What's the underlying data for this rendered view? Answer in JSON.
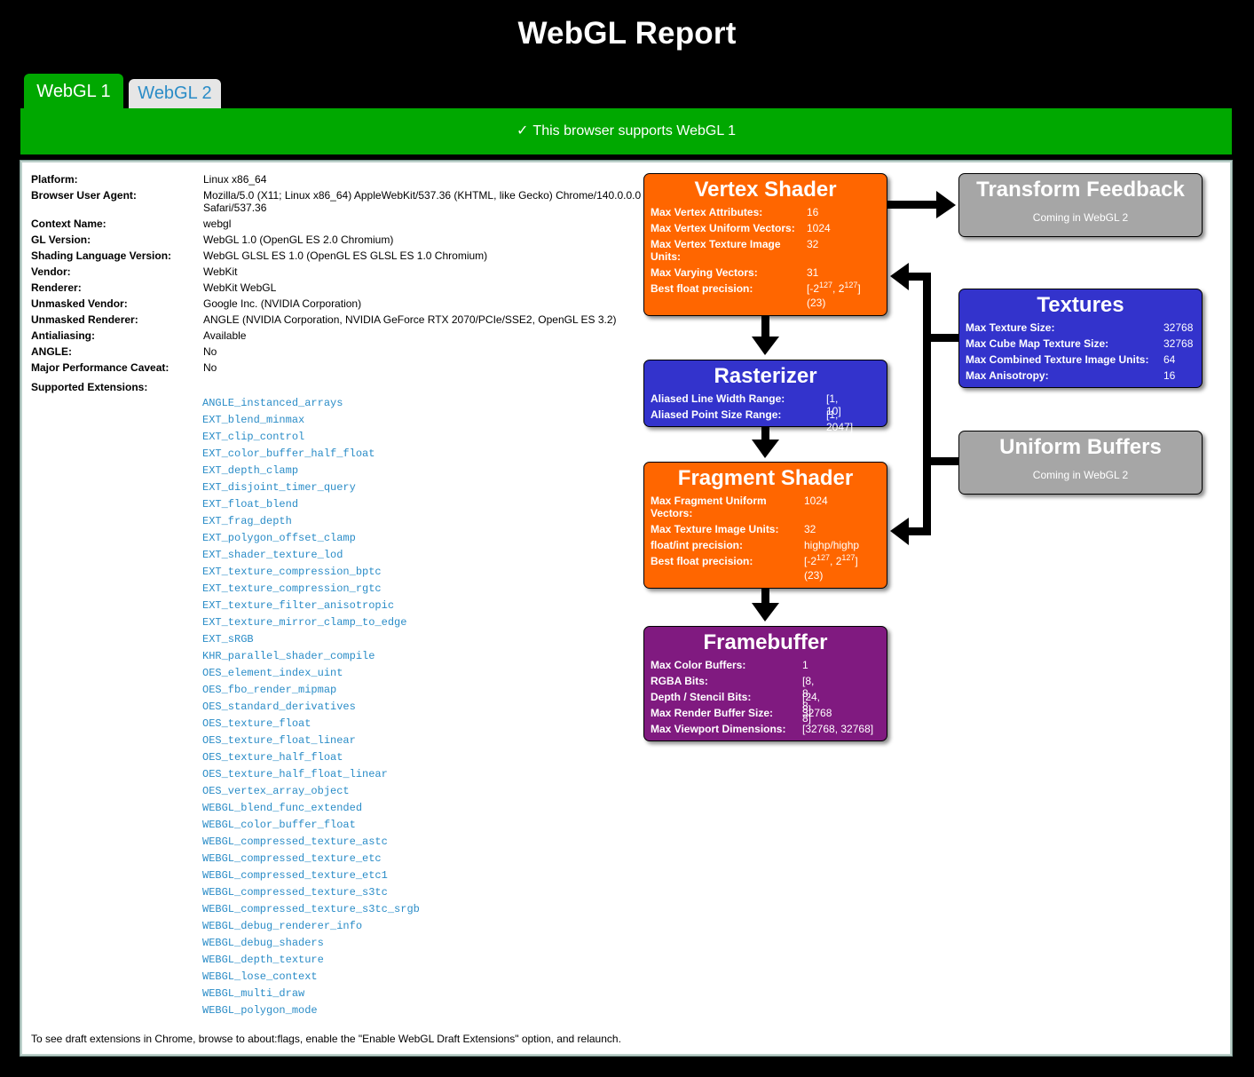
{
  "page_title": "WebGL Report",
  "tabs": [
    {
      "label": "WebGL 1",
      "active": true
    },
    {
      "label": "WebGL 2",
      "active": false
    }
  ],
  "status": {
    "check_icon": "✓",
    "message": "This browser supports WebGL 1"
  },
  "info": [
    {
      "label": "Platform:",
      "value": "Linux x86_64"
    },
    {
      "label": "Browser User Agent:",
      "value": "Mozilla/5.0 (X11; Linux x86_64) AppleWebKit/537.36 (KHTML, like Gecko) Chrome/140.0.0.0",
      "value2": "Safari/537.36"
    },
    {
      "label": "Context Name:",
      "value": "webgl"
    },
    {
      "label": "GL Version:",
      "value": "WebGL 1.0 (OpenGL ES 2.0 Chromium)"
    },
    {
      "label": "Shading Language Version:",
      "value": "WebGL GLSL ES 1.0 (OpenGL ES GLSL ES 1.0 Chromium)"
    },
    {
      "label": "Vendor:",
      "value": "WebKit"
    },
    {
      "label": "Renderer:",
      "value": "WebKit WebGL"
    },
    {
      "label": "Unmasked Vendor:",
      "value": "Google Inc. (NVIDIA Corporation)"
    },
    {
      "label": "Unmasked Renderer:",
      "value": "ANGLE (NVIDIA Corporation, NVIDIA GeForce RTX 2070/PCIe/SSE2, OpenGL ES 3.2)"
    },
    {
      "label": "Antialiasing:",
      "value": "Available"
    },
    {
      "label": "ANGLE:",
      "value": "No"
    },
    {
      "label": "Major Performance Caveat:",
      "value": "No"
    },
    {
      "label": "Supported Extensions:",
      "value": ""
    }
  ],
  "extensions": [
    "ANGLE_instanced_arrays",
    "EXT_blend_minmax",
    "EXT_clip_control",
    "EXT_color_buffer_half_float",
    "EXT_depth_clamp",
    "EXT_disjoint_timer_query",
    "EXT_float_blend",
    "EXT_frag_depth",
    "EXT_polygon_offset_clamp",
    "EXT_shader_texture_lod",
    "EXT_texture_compression_bptc",
    "EXT_texture_compression_rgtc",
    "EXT_texture_filter_anisotropic",
    "EXT_texture_mirror_clamp_to_edge",
    "EXT_sRGB",
    "KHR_parallel_shader_compile",
    "OES_element_index_uint",
    "OES_fbo_render_mipmap",
    "OES_standard_derivatives",
    "OES_texture_float",
    "OES_texture_float_linear",
    "OES_texture_half_float",
    "OES_texture_half_float_linear",
    "OES_vertex_array_object",
    "WEBGL_blend_func_extended",
    "WEBGL_color_buffer_float",
    "WEBGL_compressed_texture_astc",
    "WEBGL_compressed_texture_etc",
    "WEBGL_compressed_texture_etc1",
    "WEBGL_compressed_texture_s3tc",
    "WEBGL_compressed_texture_s3tc_srgb",
    "WEBGL_debug_renderer_info",
    "WEBGL_debug_shaders",
    "WEBGL_depth_texture",
    "WEBGL_lose_context",
    "WEBGL_multi_draw",
    "WEBGL_polygon_mode"
  ],
  "footer_note": "To see draft extensions in Chrome, browse to about:flags, enable the \"Enable WebGL Draft Extensions\" option, and relaunch.",
  "pipeline": {
    "vertex_shader": {
      "title": "Vertex Shader",
      "color": "#ff6600",
      "rows": [
        {
          "key": "Max Vertex Attributes:",
          "value": "16"
        },
        {
          "key": "Max Vertex Uniform Vectors:",
          "value": "1024"
        },
        {
          "key": "Max Vertex Texture Image",
          "key2": "Units:",
          "value": "32"
        },
        {
          "key": "Max Varying Vectors:",
          "value": "31"
        },
        {
          "key": "Best float precision:",
          "value_pre": "[-2",
          "exp1": "127",
          "value_mid": ", 2",
          "exp2": "127",
          "value_post": "]",
          "value2": "(23)"
        }
      ]
    },
    "rasterizer": {
      "title": "Rasterizer",
      "color": "#3333cc",
      "rows": [
        {
          "key": "Aliased Line Width Range:",
          "value": "[1, 10]"
        },
        {
          "key": "Aliased Point Size Range:",
          "value": "[1, 2047]"
        }
      ]
    },
    "fragment_shader": {
      "title": "Fragment Shader",
      "color": "#ff6600",
      "rows": [
        {
          "key": "Max Fragment Uniform",
          "key2": "Vectors:",
          "value": "1024"
        },
        {
          "key": "Max Texture Image Units:",
          "value": "32"
        },
        {
          "key": "float/int precision:",
          "value": "highp/highp"
        },
        {
          "key": "Best float precision:",
          "value_pre": "[-2",
          "exp1": "127",
          "value_mid": ", 2",
          "exp2": "127",
          "value_post": "]",
          "value2": "(23)"
        }
      ]
    },
    "framebuffer": {
      "title": "Framebuffer",
      "color": "#801a80",
      "rows": [
        {
          "key": "Max Color Buffers:",
          "value": "1"
        },
        {
          "key": "RGBA Bits:",
          "value": "[8, 8, 8, 8]"
        },
        {
          "key": "Depth / Stencil Bits:",
          "value": "[24, 8]"
        },
        {
          "key": "Max Render Buffer Size:",
          "value": "32768"
        },
        {
          "key": "Max Viewport Dimensions:",
          "value": "[32768, 32768]"
        }
      ]
    },
    "transform_feedback": {
      "title": "Transform Feedback",
      "subtitle": "Coming in WebGL 2",
      "color": "#a6a6a6"
    },
    "textures": {
      "title": "Textures",
      "color": "#3333cc",
      "rows": [
        {
          "key": "Max Texture Size:",
          "value": "32768"
        },
        {
          "key": "Max Cube Map Texture Size:",
          "value": "32768"
        },
        {
          "key": "Max Combined Texture Image Units:",
          "value": "64"
        },
        {
          "key": "Max Anisotropy:",
          "value": "16"
        }
      ]
    },
    "uniform_buffers": {
      "title": "Uniform Buffers",
      "subtitle": "Coming in WebGL 2",
      "color": "#a6a6a6"
    }
  }
}
